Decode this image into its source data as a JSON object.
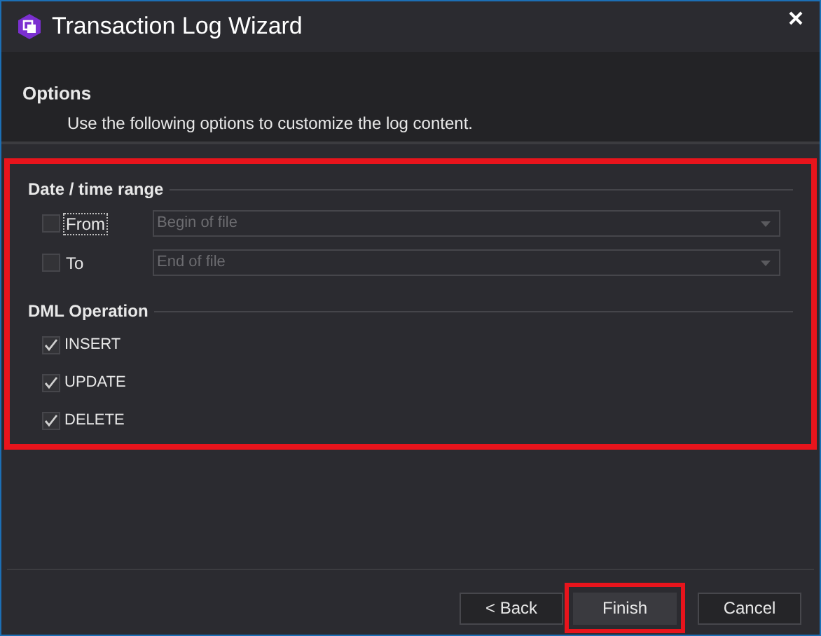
{
  "window": {
    "title": "Transaction Log Wizard"
  },
  "header": {
    "title": "Options",
    "description": "Use the following options to customize the log content."
  },
  "options_panel": {
    "highlighted": true,
    "date_range": {
      "title": "Date / time range",
      "rows": [
        {
          "label": "From",
          "checked": false,
          "focused": true,
          "value": "Begin of file",
          "disabled": true
        },
        {
          "label": "To",
          "checked": false,
          "focused": false,
          "value": "End of file",
          "disabled": true
        }
      ]
    },
    "dml": {
      "title": "DML Operation",
      "items": [
        {
          "label": "INSERT",
          "checked": true
        },
        {
          "label": "UPDATE",
          "checked": true
        },
        {
          "label": "DELETE",
          "checked": true
        }
      ]
    }
  },
  "buttons": [
    {
      "label": "< Back",
      "highlighted": false
    },
    {
      "label": "Finish",
      "highlighted": true
    },
    {
      "label": "Cancel",
      "highlighted": false
    }
  ]
}
